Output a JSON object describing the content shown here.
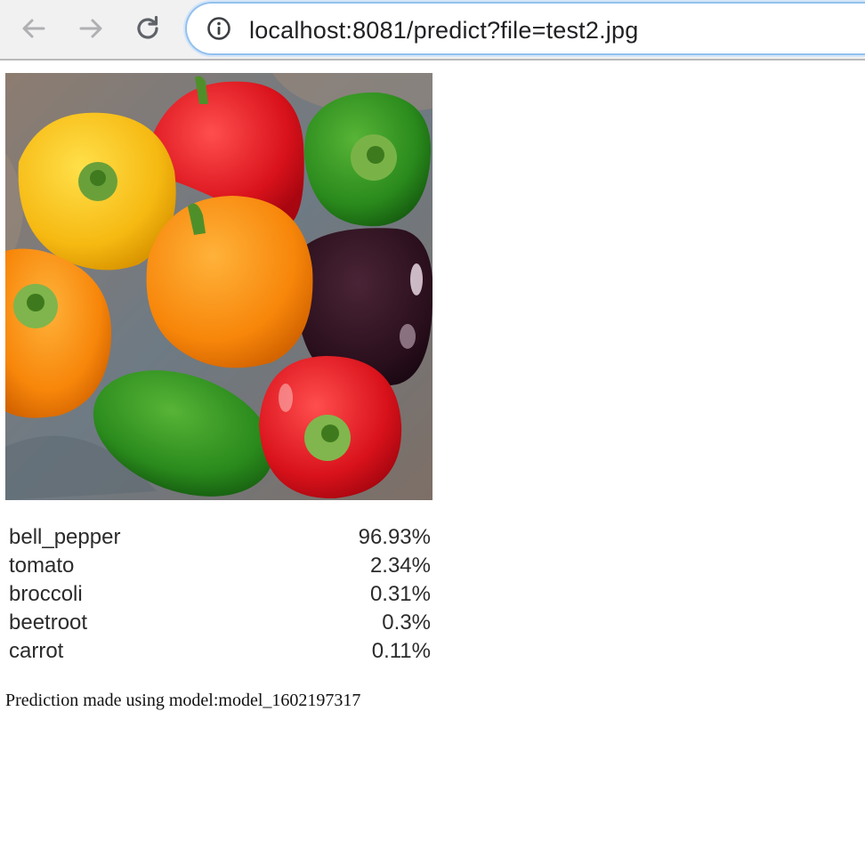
{
  "browser": {
    "url": "localhost:8081/predict?file=test2.jpg",
    "icons": {
      "back": "arrow-left-icon",
      "forward": "arrow-right-icon",
      "reload": "reload-icon",
      "info": "info-icon"
    },
    "colors": {
      "toolbar_bg": "#f1f1f2",
      "urlbar_border": "#93c1ee",
      "icon": "#b0b0b3",
      "reload_icon": "#5f6368"
    }
  },
  "predictions": [
    {
      "label": "bell_pepper",
      "value": "96.93%"
    },
    {
      "label": "tomato",
      "value": "2.34%"
    },
    {
      "label": "broccoli",
      "value": "0.31%"
    },
    {
      "label": "beetroot",
      "value": "0.3%"
    },
    {
      "label": "carrot",
      "value": "0.11%"
    }
  ],
  "footer": {
    "model_text": "Prediction made using model:model_1602197317"
  }
}
